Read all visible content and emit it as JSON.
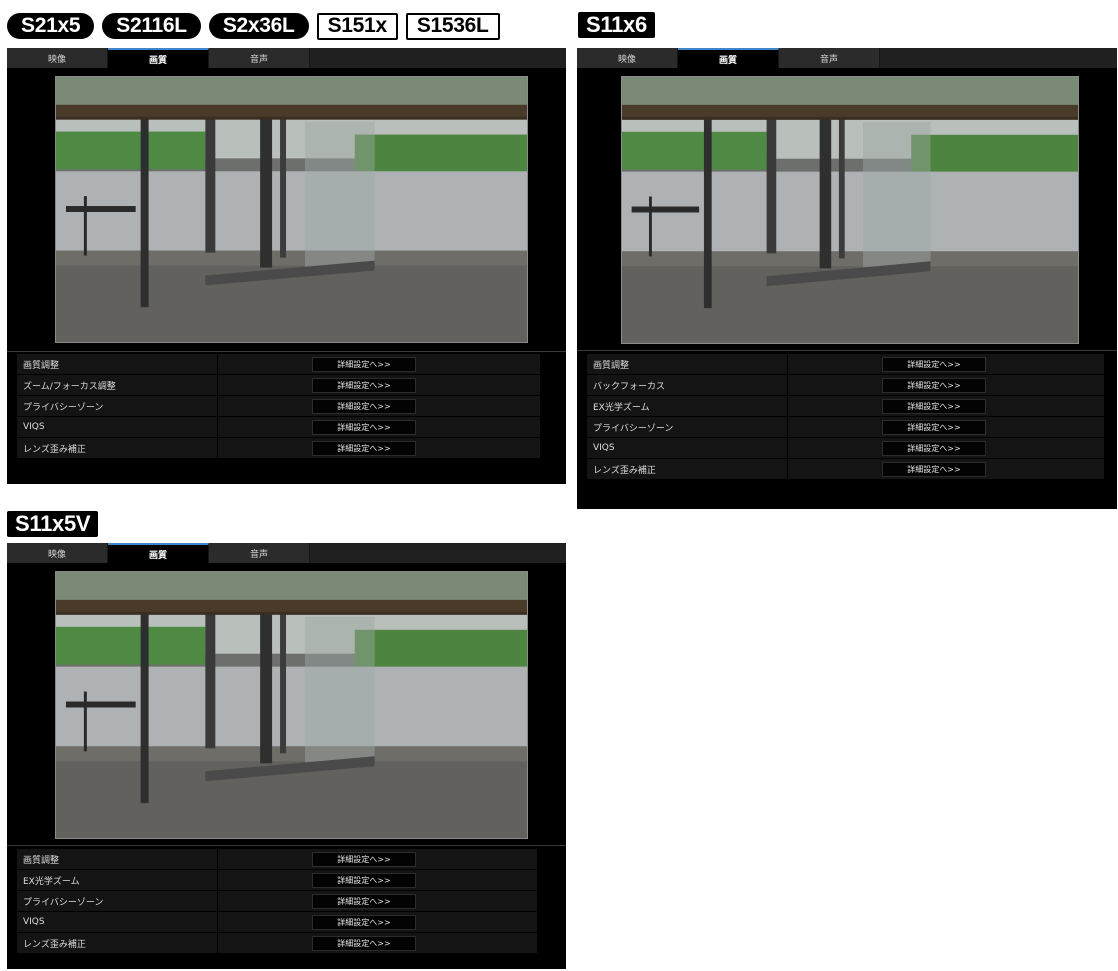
{
  "badge_groups": [
    {
      "badges": [
        {
          "text": "S21x5",
          "style": "pill"
        },
        {
          "text": "S2116L",
          "style": "pill"
        },
        {
          "text": "S2x36L",
          "style": "pill"
        },
        {
          "text": "S151x",
          "style": "box"
        },
        {
          "text": "S1536L",
          "style": "box"
        }
      ]
    },
    {
      "badges": [
        {
          "text": "S11x6",
          "style": "dark"
        }
      ]
    },
    {
      "badges": [
        {
          "text": "S11x5V",
          "style": "dark"
        }
      ]
    }
  ],
  "panels": [
    {
      "tabs": [
        {
          "label": "映像",
          "active": false
        },
        {
          "label": "画質",
          "active": true
        },
        {
          "label": "音声",
          "active": false
        }
      ],
      "rows": [
        {
          "label": "画質調整",
          "button": "詳細設定へ>>"
        },
        {
          "label": "ズーム/フォーカス調整",
          "button": "詳細設定へ>>"
        },
        {
          "label": "プライバシーゾーン",
          "button": "詳細設定へ>>"
        },
        {
          "label": "VIQS",
          "button": "詳細設定へ>>"
        },
        {
          "label": "レンズ歪み補正",
          "button": "詳細設定へ>>"
        }
      ]
    },
    {
      "tabs": [
        {
          "label": "映像",
          "active": false
        },
        {
          "label": "画質",
          "active": true
        },
        {
          "label": "音声",
          "active": false
        }
      ],
      "rows": [
        {
          "label": "画質調整",
          "button": "詳細設定へ>>"
        },
        {
          "label": "バックフォーカス",
          "button": "詳細設定へ>>"
        },
        {
          "label": "EX光学ズーム",
          "button": "詳細設定へ>>"
        },
        {
          "label": "プライバシーゾーン",
          "button": "詳細設定へ>>"
        },
        {
          "label": "VIQS",
          "button": "詳細設定へ>>"
        },
        {
          "label": "レンズ歪み補正",
          "button": "詳細設定へ>>"
        }
      ]
    },
    {
      "tabs": [
        {
          "label": "映像",
          "active": false
        },
        {
          "label": "画質",
          "active": true
        },
        {
          "label": "音声",
          "active": false
        }
      ],
      "rows": [
        {
          "label": "画質調整",
          "button": "詳細設定へ>>"
        },
        {
          "label": "EX光学ズーム",
          "button": "詳細設定へ>>"
        },
        {
          "label": "プライバシーゾーン",
          "button": "詳細設定へ>>"
        },
        {
          "label": "VIQS",
          "button": "詳細設定へ>>"
        },
        {
          "label": "レンズ歪み補正",
          "button": "詳細設定へ>>"
        }
      ]
    }
  ]
}
